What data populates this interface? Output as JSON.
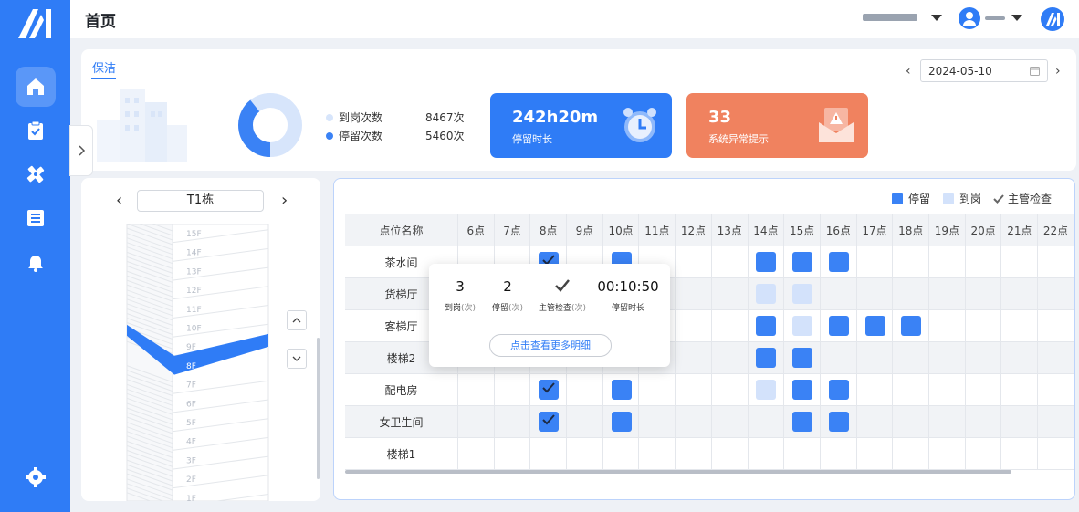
{
  "header": {
    "title": "首页"
  },
  "sidebar": {
    "items": [
      {
        "icon": "home-icon",
        "active": true
      },
      {
        "icon": "clipboard-check-icon"
      },
      {
        "icon": "tools-icon"
      },
      {
        "icon": "list-icon"
      },
      {
        "icon": "bell-icon"
      },
      {
        "icon": "settings-icon"
      }
    ]
  },
  "summary": {
    "tab_label": "保洁",
    "donut": {
      "arrive_count": 8467,
      "stay_count": 5460,
      "arrive_color": "#d7e5fb",
      "stay_color": "#3a82f5"
    },
    "legend": [
      {
        "label": "到岗次数",
        "value": "8467次"
      },
      {
        "label": "停留次数",
        "value": "5460次"
      }
    ],
    "cards": [
      {
        "value": "242h20m",
        "label": "停留时长",
        "icon": "alarm-clock-icon",
        "color": "#2f7cf6"
      },
      {
        "value": "33",
        "label": "系统异常提示",
        "icon": "warning-mail-icon",
        "color": "#f0825f"
      }
    ],
    "date": "2024-05-10"
  },
  "building": {
    "name": "T1栋",
    "floors": [
      "15F",
      "14F",
      "13F",
      "12F",
      "11F",
      "10F",
      "9F",
      "8F",
      "7F",
      "6F",
      "5F",
      "4F",
      "3F",
      "2F",
      "1F"
    ],
    "selected_floor": "8F"
  },
  "schedule": {
    "legend": [
      {
        "label": "停留",
        "color": "#3a82f5"
      },
      {
        "label": "到岗",
        "color": "#d3e2fb"
      },
      {
        "label": "主管检查",
        "icon": "check-icon"
      }
    ],
    "column_header": "点位名称",
    "hours": [
      "6点",
      "7点",
      "8点",
      "9点",
      "10点",
      "11点",
      "12点",
      "13点",
      "14点",
      "15点",
      "16点",
      "17点",
      "18点",
      "19点",
      "20点",
      "21点",
      "22点"
    ],
    "rows": [
      {
        "name": "茶水间",
        "cells": {
          "8点": "stay-check",
          "10点": "stay",
          "14点": "stay",
          "15点": "stay",
          "16点": "stay"
        }
      },
      {
        "name": "货梯厅",
        "cells": {
          "14点": "arrive",
          "15点": "arrive"
        }
      },
      {
        "name": "客梯厅",
        "cells": {
          "14点": "stay",
          "15点": "arrive",
          "16点": "stay",
          "17点": "stay",
          "18点": "stay"
        }
      },
      {
        "name": "楼梯2",
        "cells": {
          "14点": "stay",
          "15点": "stay"
        }
      },
      {
        "name": "配电房",
        "cells": {
          "8点": "stay-check",
          "10点": "stay",
          "14点": "arrive",
          "15点": "stay",
          "16点": "stay"
        }
      },
      {
        "name": "女卫生间",
        "cells": {
          "8点": "stay-check",
          "10点": "stay",
          "15点": "stay",
          "16点": "stay"
        }
      },
      {
        "name": "楼梯1",
        "cells": {}
      }
    ]
  },
  "popover": {
    "stats": [
      {
        "value": "3",
        "label": "到岗",
        "unit": "(次)"
      },
      {
        "value": "2",
        "label": "停留",
        "unit": "(次)"
      },
      {
        "icon": "check-icon",
        "label": "主管检查",
        "unit": "(次)"
      },
      {
        "value": "00:10:50",
        "label": "停留时长",
        "unit": ""
      }
    ],
    "button": "点击查看更多明细"
  }
}
